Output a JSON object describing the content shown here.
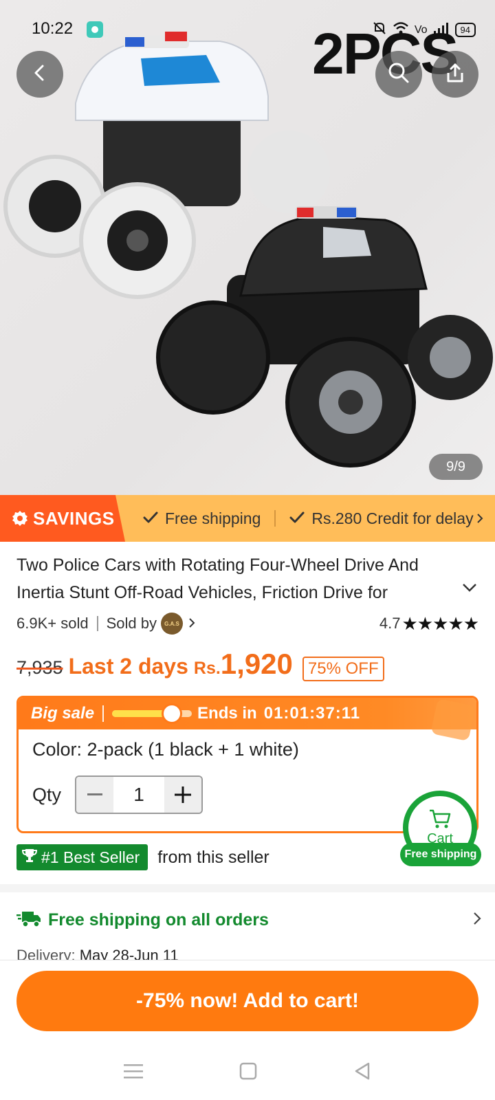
{
  "status_bar": {
    "time": "10:22",
    "network": "Vo",
    "battery": "94"
  },
  "hero": {
    "promo_text": "2PCS",
    "image_counter": "9/9",
    "icons": [
      "back-arrow-icon",
      "search-icon",
      "share-icon"
    ]
  },
  "savings_bar": {
    "tag": "SAVINGS",
    "perks": [
      "Free shipping",
      "Rs.280 Credit for delay"
    ]
  },
  "product": {
    "title": "Two Police Cars with Rotating Four-Wheel Drive And Inertia Stunt Off-Road Vehicles, Friction Drive for",
    "sold": "6.9K+ sold",
    "sold_by_label": "Sold by",
    "seller_logo_text": "G.A.S",
    "rating": "4.7",
    "stars": "★★★★★"
  },
  "price": {
    "old_price": "7,935",
    "urgency": "Last 2 days",
    "currency": "Rs.",
    "current": "1,920",
    "discount": "75% OFF"
  },
  "big_sale": {
    "label": "Big sale",
    "progress": 0.75,
    "ends_label": "Ends in",
    "countdown": "01:01:37:11",
    "color_line": "Color: 2-pack (1 black + 1 white)",
    "qty_label": "Qty",
    "qty_value": "1"
  },
  "cart_fab": {
    "label": "Cart",
    "badge": "Free shipping"
  },
  "best_seller": {
    "badge": "#1 Best Seller",
    "text": "from this seller"
  },
  "shipping": {
    "title": "Free shipping on all orders",
    "delivery_label": "Delivery:",
    "delivery_dates": "May 28-Jun 11"
  },
  "cta": {
    "label": "-75% now! Add to cart!"
  },
  "colors": {
    "brand_orange": "#ff7a0f",
    "savings_bg": "#ffbd59",
    "green": "#138a2e"
  }
}
